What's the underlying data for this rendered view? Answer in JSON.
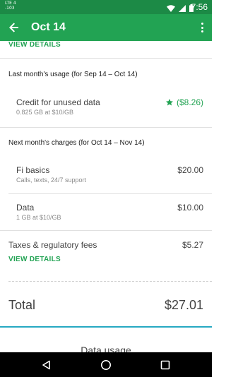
{
  "status_bar": {
    "signal_label": "LTE 4\n-103",
    "time": "7:56",
    "icons": [
      "wifi-icon",
      "signal-icon",
      "battery-icon"
    ],
    "color": "#1c8a46"
  },
  "app_bar": {
    "title": "Oct 14",
    "color": "#22a353",
    "back_icon": "arrow-left-icon",
    "menu_icon": "more-vert-icon"
  },
  "top_link": "VIEW DETAILS",
  "last_month": {
    "title": "Last month's usage (for Sep 14 – Oct 14)",
    "credit": {
      "label": "Credit for unused data",
      "sub": "0.825 GB at $10/GB",
      "amount": "($8.26)",
      "icon": "star-icon"
    }
  },
  "next_month": {
    "title": "Next month's charges (for Oct 14 – Nov 14)",
    "fi_basics": {
      "label": "Fi basics",
      "sub": "Calls, texts, 24/7 support",
      "amount": "$20.00"
    },
    "data": {
      "label": "Data",
      "sub": "1 GB at $10/GB",
      "amount": "$10.00"
    }
  },
  "taxes": {
    "label": "Taxes & regulatory fees",
    "amount": "$5.27",
    "link": "VIEW DETAILS"
  },
  "total": {
    "label": "Total",
    "amount": "$27.01"
  },
  "next_section_label": "Data usage",
  "accent_color": "#22a353",
  "divider_accent": "#26a9c2",
  "nav_bar": {
    "buttons": [
      "back-triangle-icon",
      "home-circle-icon",
      "recents-square-icon"
    ]
  }
}
